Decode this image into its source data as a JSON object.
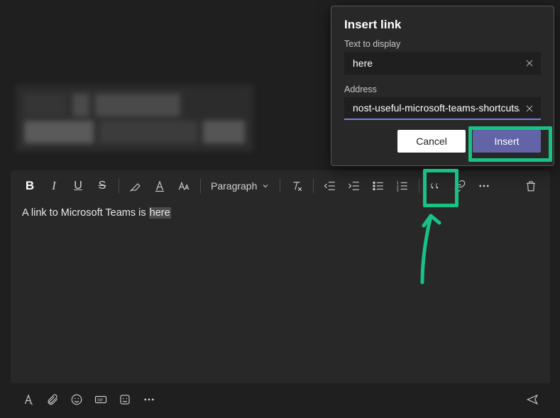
{
  "dialog": {
    "title": "Insert link",
    "text_label": "Text to display",
    "text_value": "here",
    "address_label": "Address",
    "address_value": "nost-useful-microsoft-teams-shortcuts/",
    "cancel_label": "Cancel",
    "insert_label": "Insert"
  },
  "toolbar": {
    "bold": "B",
    "italic": "I",
    "underline": "U",
    "strike": "S",
    "paragraph_label": "Paragraph"
  },
  "editor": {
    "text_before": "A link to Microsoft Teams is ",
    "text_selected": "here"
  },
  "bottom": {
    "gif": "GIF"
  }
}
